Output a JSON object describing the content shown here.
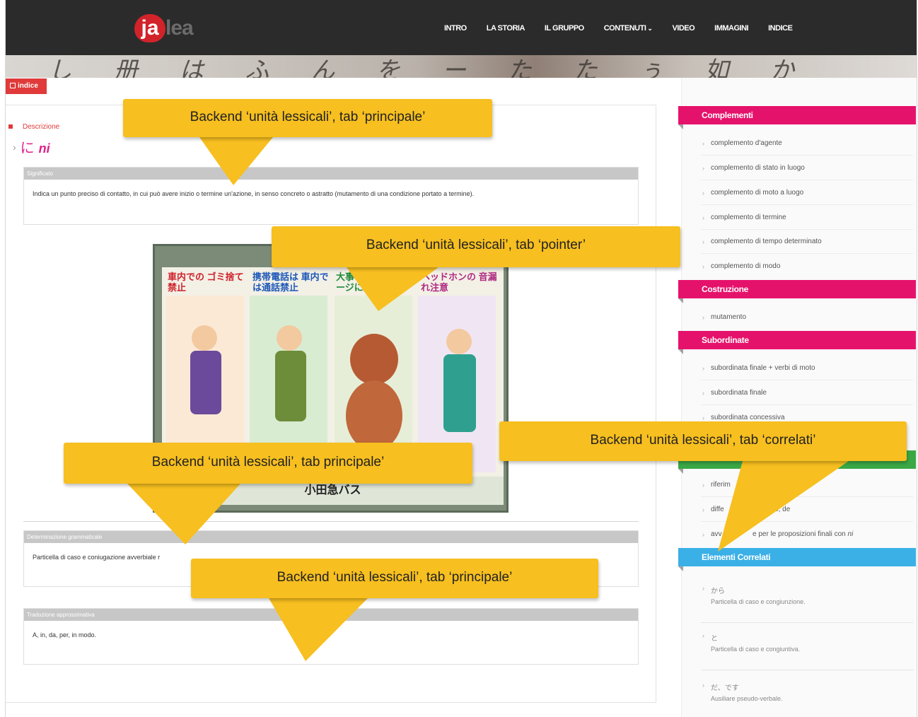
{
  "header": {
    "logo_ja": "ja",
    "logo_lea": "lea",
    "nav": [
      {
        "label": "INTRO"
      },
      {
        "label": "LA STORIA"
      },
      {
        "label": "IL GRUPPO"
      },
      {
        "label": "CONTENUTI",
        "chevron": "⌄"
      },
      {
        "label": "VIDEO"
      },
      {
        "label": "IMMAGINI"
      },
      {
        "label": "INDICE"
      }
    ],
    "banner_text": "し 册 は ふ ん を ー た た ぅ 如 か"
  },
  "indice_button": "indice",
  "main": {
    "description_label": "Descrizione",
    "word_kana": "に",
    "word_romaji": "ni",
    "panels": {
      "significato": {
        "title": "Significato",
        "body": "Indica un punto preciso di contatto, in cui può avere inizio o termine un'azione, in senso concreto o astratto (mutamento di una condizione portato a termine)."
      },
      "determinazione": {
        "title": "Determinazione grammaticale",
        "body": "Particella di caso e coniugazione avverbiale r"
      },
      "traduzione": {
        "title": "Traduzione approssimativa",
        "body": "A, in, da, per, in modo."
      }
    },
    "photo_texts": {
      "t1": "車内での ゴミ捨て禁止",
      "t2": "携帯電話は 車内では通話禁止",
      "t3": "大事なペットは ケージに入れて",
      "t4": "ヘッドホンの 音漏れ注意",
      "bottom": "小田急バス"
    }
  },
  "sidebar": {
    "complementi": {
      "title": "Complementi",
      "items": [
        "complemento d'agente",
        "complemento di stato in luogo",
        "complemento di moto a luogo",
        "complemento di termine",
        "complemento di tempo determinato",
        "complemento di modo"
      ]
    },
    "costruzione": {
      "title": "Costruzione",
      "items": [
        "mutamento"
      ]
    },
    "subordinate": {
      "title": "Subordinate",
      "items": [
        "subordinata finale + verbi di moto",
        "subordinata finale",
        "subordinata concessiva"
      ]
    },
    "riferimenti": {
      "items": [
        "riferim",
        "diffe",
        "avv"
      ],
      "item2_tail": "ara, e, de",
      "item3_tail": "e per le proposizioni finali con ",
      "item3_ni": "ni"
    },
    "correlati": {
      "title": "Elementi Correlati",
      "items": [
        {
          "kana": "から",
          "desc": "Particella di caso e congiunzione."
        },
        {
          "kana": "と",
          "desc": "Particella di caso e congiuntiva."
        },
        {
          "kana": "だ、です",
          "desc": "Ausiliare pseudo-verbale."
        }
      ]
    }
  },
  "callouts": {
    "c1": "Backend ‘unità lessicali’, tab ‘principale’",
    "c2": "Backend ‘unità lessicali’, tab ‘pointer’",
    "c3": "Backend ‘unità lessicali’, tab principale’",
    "c4": "Backend ‘unità lessicali’, tab ‘correlati’",
    "c5": "Backend ‘unità lessicali’, tab ‘principale’"
  },
  "colors": {
    "accent_red": "#e03a3a",
    "section_pink": "#e5126b",
    "section_green": "#3aa845",
    "section_blue": "#3ab0e6",
    "callout_yellow": "#f7bf1f"
  }
}
